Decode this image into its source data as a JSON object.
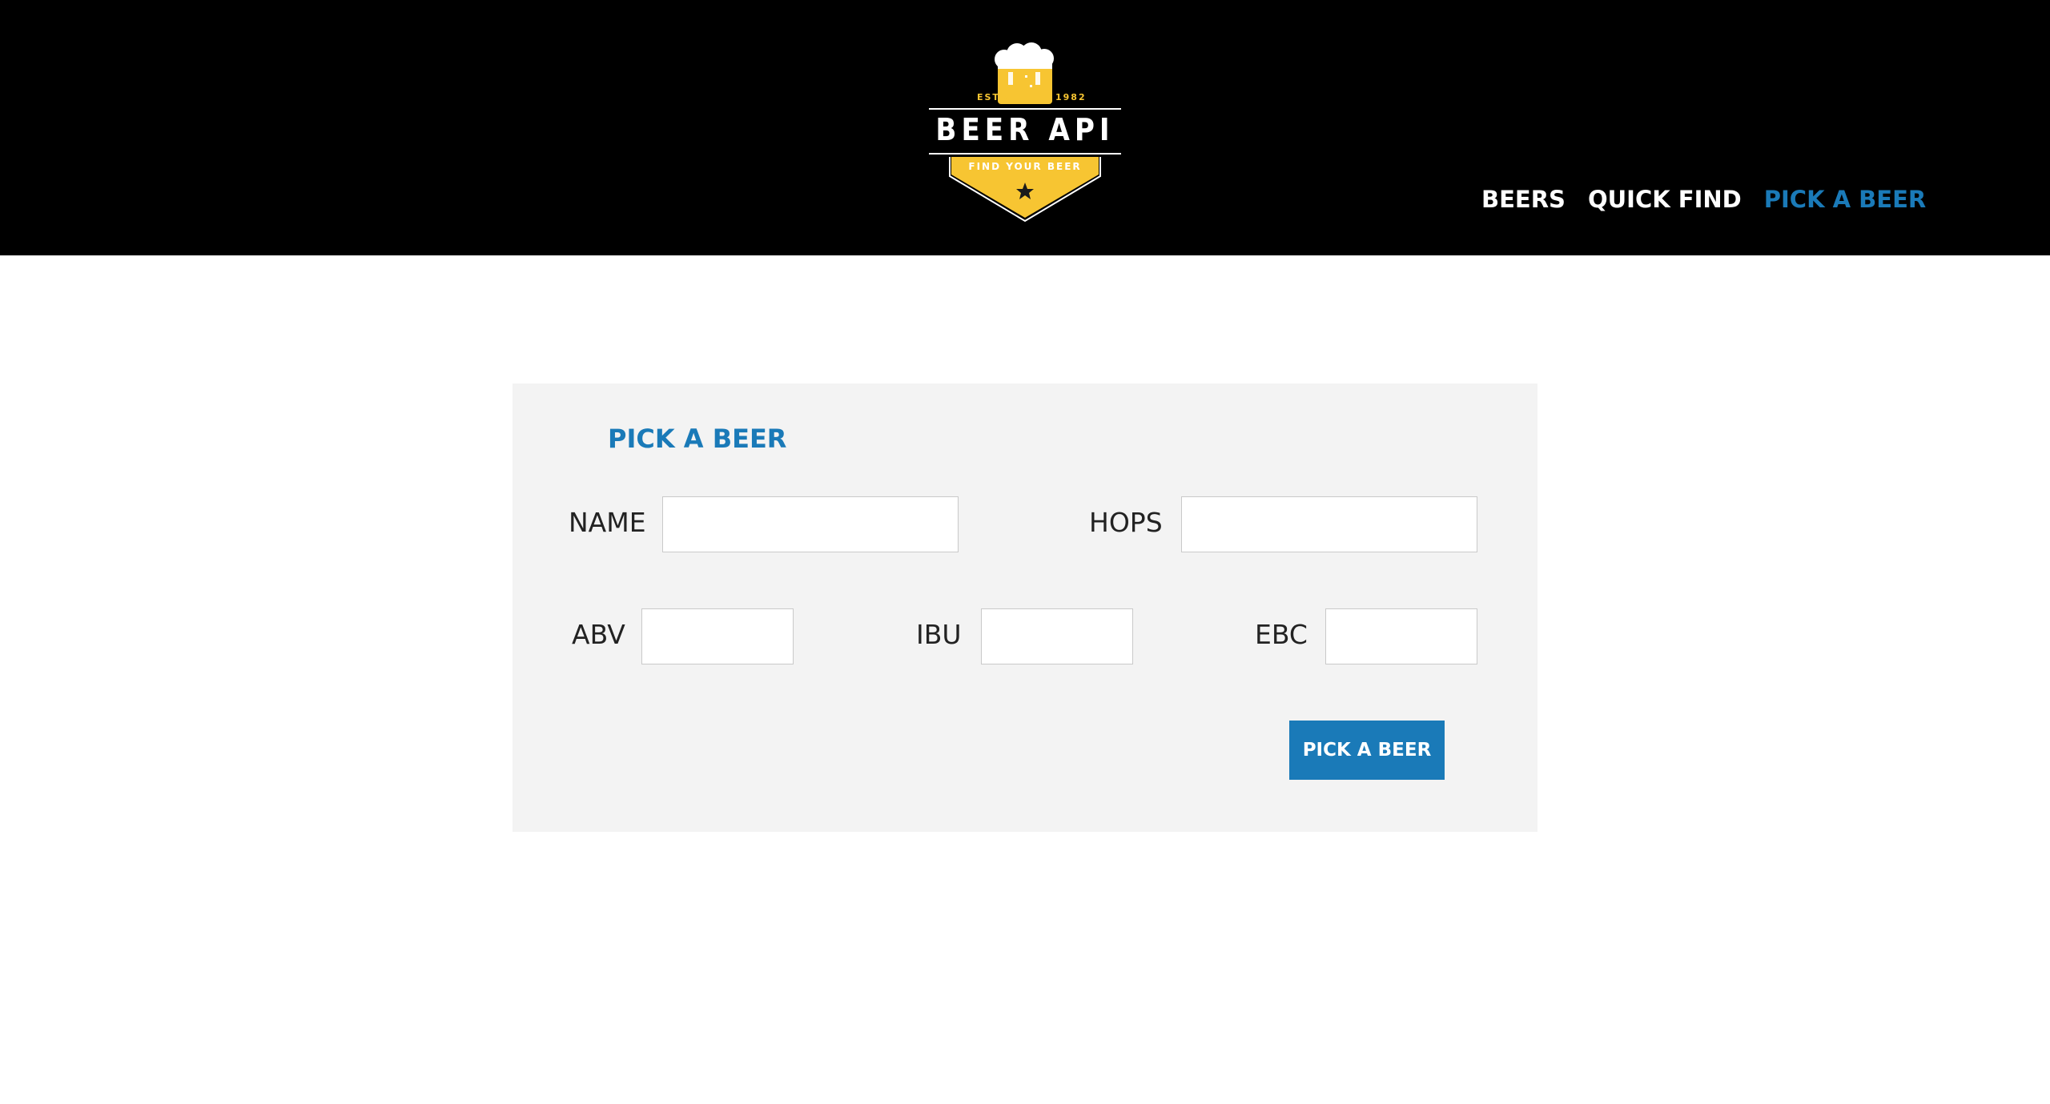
{
  "logo": {
    "estb": "ESTB",
    "year": "1982",
    "title": "BEER API",
    "tagline": "FIND YOUR BEER"
  },
  "nav": {
    "items": [
      {
        "label": "BEERS",
        "active": false
      },
      {
        "label": "QUICK FIND",
        "active": false
      },
      {
        "label": "PICK A BEER",
        "active": true
      }
    ]
  },
  "form": {
    "title": "PICK A BEER",
    "fields": {
      "name": {
        "label": "NAME",
        "value": ""
      },
      "hops": {
        "label": "HOPS",
        "value": ""
      },
      "abv": {
        "label": "ABV",
        "value": ""
      },
      "ibu": {
        "label": "IBU",
        "value": ""
      },
      "ebc": {
        "label": "EBC",
        "value": ""
      }
    },
    "submit_label": "PICK A BEER"
  },
  "colors": {
    "header_bg": "#000000",
    "accent": "#1a7ab8",
    "logo_yellow": "#f7c532",
    "panel_bg": "#f3f3f3"
  }
}
